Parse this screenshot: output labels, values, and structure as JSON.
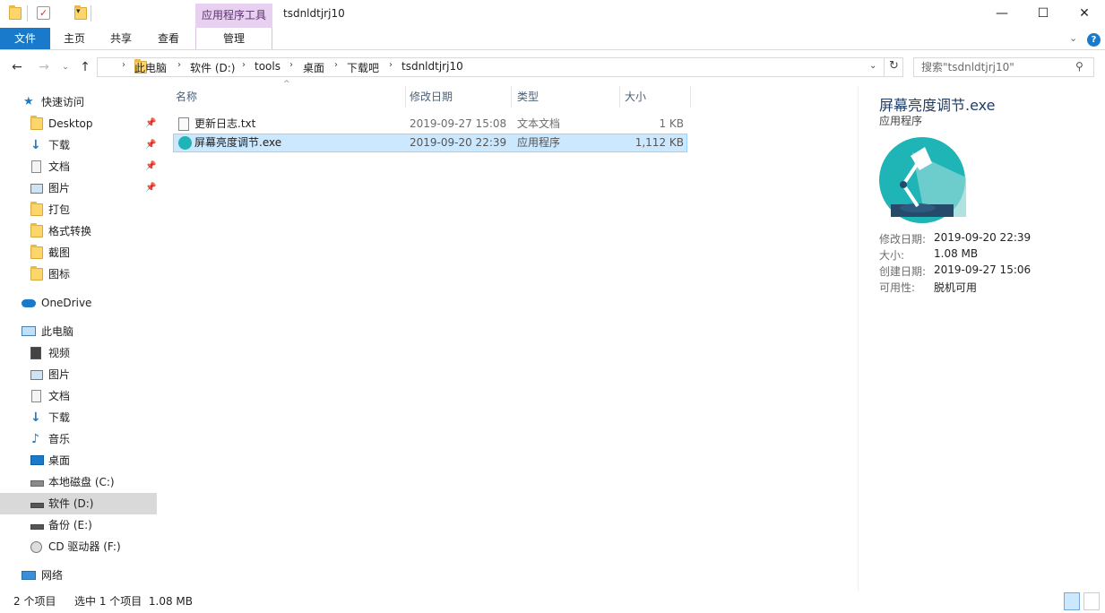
{
  "window": {
    "title": "tsdnldtjrj10",
    "context_tab_title": "应用程序工具",
    "minimize": "—",
    "maximize": "☐",
    "close": "✕"
  },
  "ribbon": {
    "tabs": [
      "文件",
      "主页",
      "共享",
      "查看"
    ],
    "manage_tab": "管理",
    "help": "?"
  },
  "address": {
    "crumbs": [
      "此电脑",
      "软件 (D:)",
      "tools",
      "桌面",
      "下载吧",
      "tsdnldtjrj10"
    ],
    "search_placeholder": "搜索\"tsdnldtjrj10\""
  },
  "nav": {
    "quick_access": "快速访问",
    "quick_items": [
      "Desktop",
      "下载",
      "文档",
      "图片",
      "打包",
      "格式转换",
      "截图",
      "图标"
    ],
    "onedrive": "OneDrive",
    "this_pc": "此电脑",
    "pc_items": [
      "视频",
      "图片",
      "文档",
      "下载",
      "音乐",
      "桌面",
      "本地磁盘 (C:)",
      "软件 (D:)",
      "备份 (E:)",
      "CD 驱动器 (F:)"
    ],
    "network": "网络"
  },
  "file_list": {
    "columns": [
      "名称",
      "修改日期",
      "类型",
      "大小"
    ],
    "rows": [
      {
        "name": "更新日志.txt",
        "date": "2019-09-27 15:08",
        "type": "文本文档",
        "size": "1 KB"
      },
      {
        "name": "屏幕亮度调节.exe",
        "date": "2019-09-20 22:39",
        "type": "应用程序",
        "size": "1,112 KB"
      }
    ]
  },
  "details": {
    "title": "屏幕亮度调节.exe",
    "subtitle": "应用程序",
    "fields": [
      {
        "label": "修改日期:",
        "value": "2019-09-20 22:39"
      },
      {
        "label": "大小:",
        "value": "1.08 MB"
      },
      {
        "label": "创建日期:",
        "value": "2019-09-27 15:06"
      },
      {
        "label": "可用性:",
        "value": "脱机可用"
      }
    ]
  },
  "status": {
    "count": "2 个项目",
    "selected": "选中 1 个项目  1.08 MB"
  },
  "colors": {
    "accent": "#1979ca",
    "selection": "#cce8ff",
    "context_tab": "#e8d0f0"
  }
}
